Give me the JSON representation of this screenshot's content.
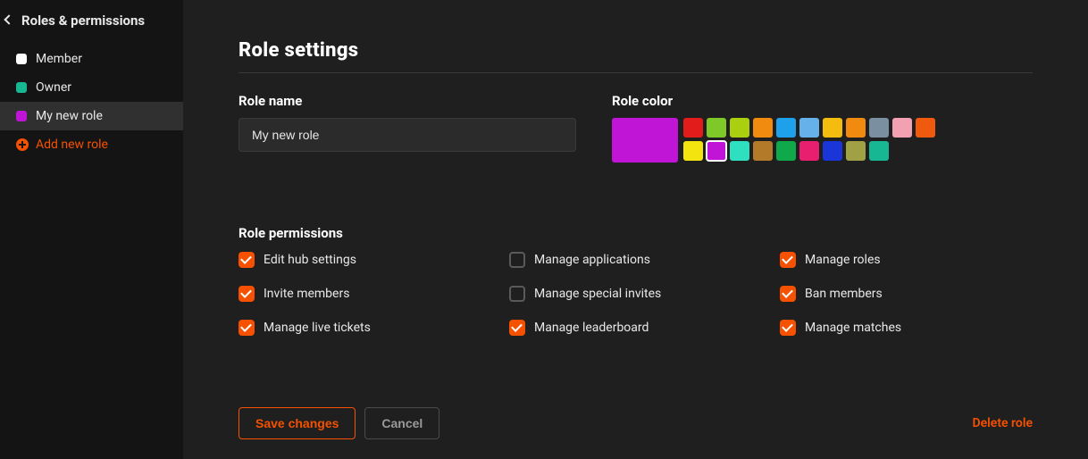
{
  "sidebar": {
    "title": "Roles & permissions",
    "roles": [
      {
        "label": "Member",
        "color": "#ffffff",
        "active": false
      },
      {
        "label": "Owner",
        "color": "#17b793",
        "active": false
      },
      {
        "label": "My new role",
        "color": "#c015d6",
        "active": true
      }
    ],
    "add_role_label": "Add new role"
  },
  "main": {
    "title": "Role settings",
    "role_name_label": "Role name",
    "role_name_value": "My new role",
    "role_color_label": "Role color",
    "big_swatch_color": "#c015d6",
    "swatches_row1": [
      "#e21b1b",
      "#7ec828",
      "#a9cf0f",
      "#f08b0f",
      "#1fa0ea",
      "#67b1ea",
      "#f3bc0f",
      "#f08b0f",
      "#7a8fa0",
      "#f3a0b3",
      "#f05a0f"
    ],
    "swatches_row2": [
      "#f3e40f",
      "#c015d6",
      "#2fe0c0",
      "#b37a2a",
      "#0fa84a",
      "#e81f6e",
      "#1a36d8",
      "#a0a044",
      "#17b793"
    ],
    "selected_swatch": "#c015d6",
    "permissions_label": "Role permissions",
    "permissions": [
      {
        "label": "Edit hub settings",
        "checked": true
      },
      {
        "label": "Manage applications",
        "checked": false
      },
      {
        "label": "Manage roles",
        "checked": true
      },
      {
        "label": "Invite members",
        "checked": true
      },
      {
        "label": "Manage special invites",
        "checked": false
      },
      {
        "label": "Ban members",
        "checked": true
      },
      {
        "label": "Manage live tickets",
        "checked": true
      },
      {
        "label": "Manage leaderboard",
        "checked": true
      },
      {
        "label": "Manage matches",
        "checked": true
      }
    ],
    "save_label": "Save changes",
    "cancel_label": "Cancel",
    "delete_label": "Delete role"
  },
  "colors": {
    "accent": "#f55100"
  }
}
